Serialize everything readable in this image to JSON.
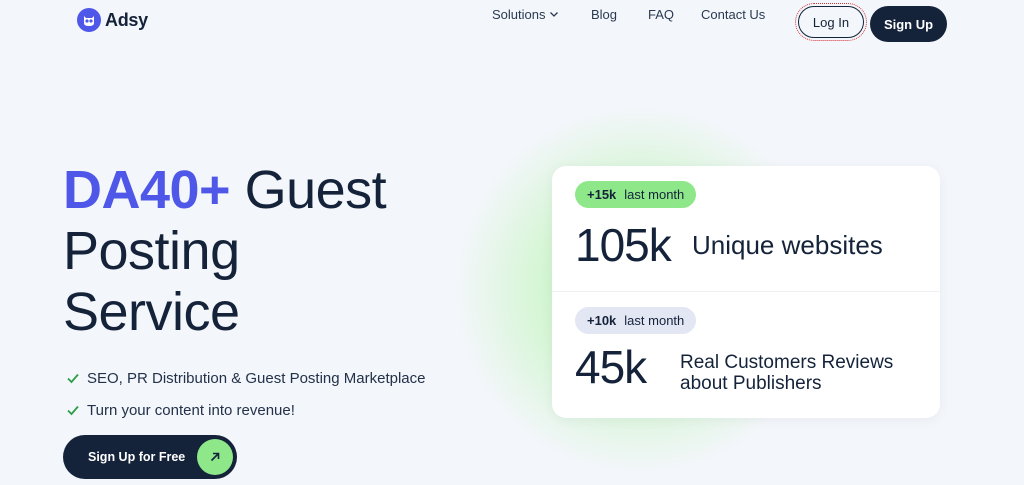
{
  "brand": {
    "name": "Adsy",
    "logo_icon": "owl-icon",
    "accent": "#4f57e8",
    "dark": "#14233a",
    "green": "#8ee88a"
  },
  "nav": {
    "solutions": "Solutions",
    "blog": "Blog",
    "faq": "FAQ",
    "contact": "Contact Us"
  },
  "header": {
    "login": "Log In",
    "signup": "Sign Up"
  },
  "hero": {
    "title_accent": "DA40+",
    "title_rest_1": " Guest",
    "title_line_2": "Posting",
    "title_line_3": "Service",
    "features": [
      "SEO, PR Distribution & Guest Posting Marketplace",
      "Turn your content into revenue!"
    ],
    "cta": "Sign Up for Free"
  },
  "stats": [
    {
      "delta": "+15k",
      "delta_label": "last month",
      "value": "105k",
      "label": "Unique websites"
    },
    {
      "delta": "+10k",
      "delta_label": "last month",
      "value": "45k",
      "label_line1": "Real Customers Reviews",
      "label_line2": "about Publishers"
    }
  ]
}
